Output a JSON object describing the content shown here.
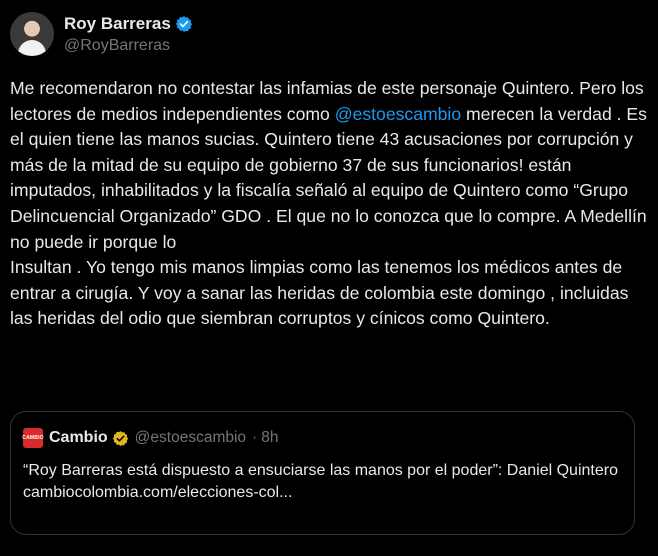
{
  "author": {
    "display_name": "Roy Barreras",
    "handle": "@RoyBarreras"
  },
  "tweet": {
    "text_before_mention": "Me recomendaron no contestar las infamias de este personaje Quintero. Pero los lectores de medios independientes como ",
    "mention": "@estoescambio",
    "text_after_mention": " merecen la verdad . Es el quien tiene las manos sucias. Quintero tiene 43 acusaciones por corrupción y más de la mitad de su equipo de gobierno 37 de sus funcionarios! están imputados, inhabilitados y la fiscalía señaló al equipo de Quintero como “Grupo Delincuencial Organizado” GDO . El que no lo conozca que lo compre. A Medellín no puede ir porque lo",
    "text_second_paragraph": "Insultan . Yo tengo mis manos limpias como las tenemos los médicos antes de entrar a cirugía. Y voy a sanar las heridas de colombia este domingo , incluidas las heridas del odio que siembran corruptos y cínicos como Quintero."
  },
  "quote": {
    "logo_text": "CAMBIO",
    "display_name": "Cambio",
    "handle": "@estoescambio",
    "separator": "·",
    "time": "8h",
    "headline": "“Roy Barreras está dispuesto a ensuciarse las manos por el poder”: Daniel Quintero",
    "link": "cambiocolombia.com/elecciones-col..."
  },
  "colors": {
    "background": "#000000",
    "text": "#e7e9ea",
    "secondary": "#71767b",
    "link": "#1d9bf0",
    "verified_blue": "#1d9bf0",
    "verified_gold": "#e2b719",
    "border": "#2f3336"
  },
  "icons": {
    "verified": "verified-badge-icon",
    "org_verified": "gold-verified-badge-icon"
  }
}
